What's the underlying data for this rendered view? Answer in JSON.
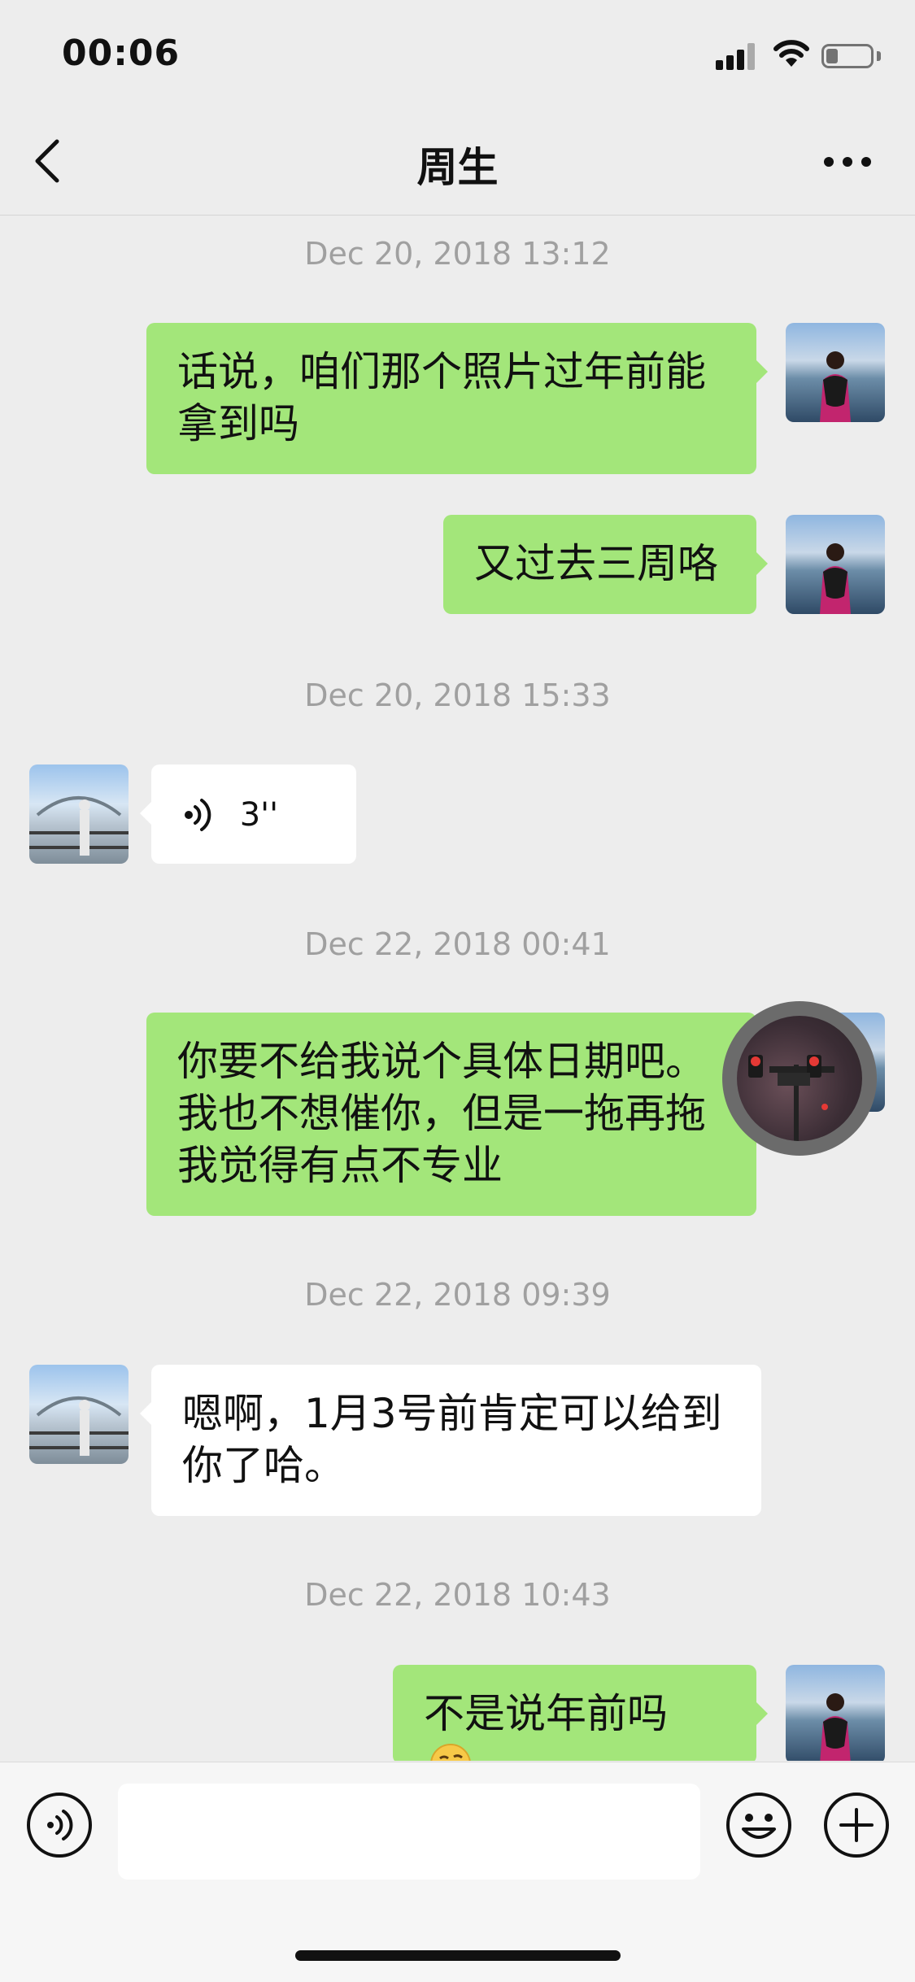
{
  "status_bar": {
    "time": "00:06"
  },
  "nav": {
    "title": "周生",
    "back_icon": "chevron-left-icon",
    "more_icon": "ellipsis-icon"
  },
  "messages": [
    {
      "type": "timestamp",
      "text": "Dec 20, 2018 13:12"
    },
    {
      "type": "text",
      "sender": "me",
      "lines": [
        "话说，咱们那个照片过年前能",
        "拿到吗"
      ]
    },
    {
      "type": "text",
      "sender": "me",
      "lines": [
        "又过去三周咯"
      ]
    },
    {
      "type": "timestamp",
      "text": "Dec 20, 2018 15:33"
    },
    {
      "type": "voice",
      "sender": "them",
      "duration": "3''"
    },
    {
      "type": "timestamp",
      "text": "Dec 22, 2018 00:41"
    },
    {
      "type": "text",
      "sender": "me",
      "lines": [
        "你要不给我说个具体日期吧。",
        "我也不想催你，但是一拖再拖",
        "我觉得有点不专业"
      ]
    },
    {
      "type": "timestamp",
      "text": "Dec 22, 2018 09:39"
    },
    {
      "type": "text",
      "sender": "them",
      "lines": [
        "嗯啊，1月3号前肯定可以给到",
        "你了哈。"
      ]
    },
    {
      "type": "timestamp",
      "text": "Dec 22, 2018 10:43"
    },
    {
      "type": "text",
      "sender": "me",
      "lines": [
        "不是说年前吗"
      ],
      "emoji": "thinking-emoji"
    }
  ],
  "input_bar": {
    "voice_icon": "voice-mode-icon",
    "emoji_icon": "emoji-icon",
    "plus_icon": "plus-icon",
    "text_value": ""
  },
  "colors": {
    "bubble_me": "#A3E67A",
    "bubble_them": "#FFFFFF",
    "background": "#EDEDED",
    "timestamp": "#A0A0A0"
  }
}
